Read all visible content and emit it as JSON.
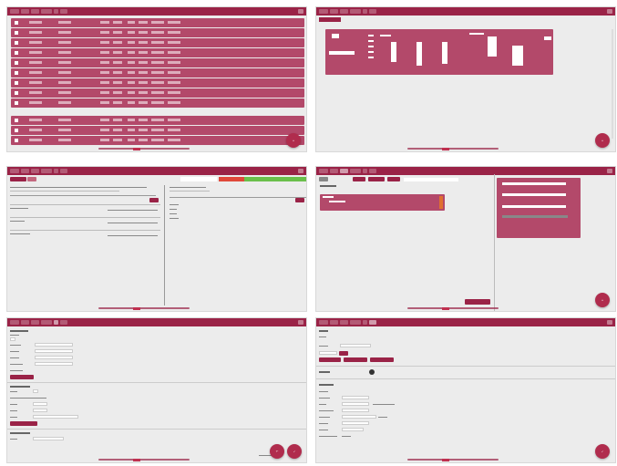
{
  "colors": {
    "brand": "#9a2347",
    "row": "#b3496a",
    "fab": "#b02c4d",
    "background": "#ececec",
    "status_red": "#e0483a",
    "status_green": "#6abf4b"
  },
  "panels": [
    {
      "id": "p1",
      "fab_icon": "plus-icon",
      "row_count": 12
    },
    {
      "id": "p2",
      "fab_icon": "plus-icon"
    },
    {
      "id": "p3",
      "fab_icon": "plus-icon"
    },
    {
      "id": "p4",
      "fab_icon": "plus-icon"
    },
    {
      "id": "p5",
      "fab_icons": [
        "undo-icon",
        "save-icon"
      ]
    },
    {
      "id": "p6",
      "fab_icon": "save-icon",
      "toggle_state": "on"
    }
  ]
}
